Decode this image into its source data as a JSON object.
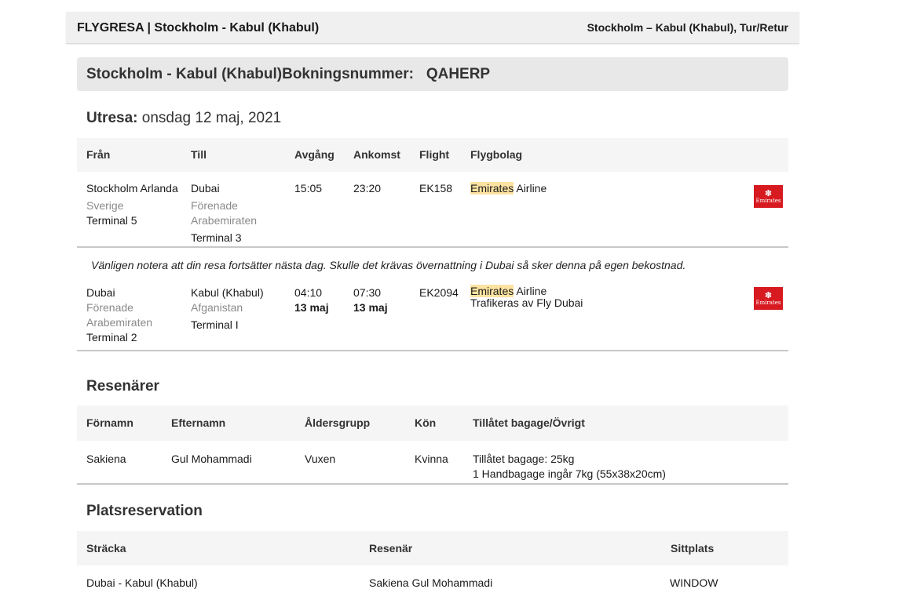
{
  "header": {
    "title": "FLYGRESA | Stockholm - Kabul (Khabul)",
    "route": "Stockholm – Kabul (Khabul), Tur/Retur"
  },
  "booking": {
    "route": "Stockholm - Kabul (Khabul)",
    "label": "Bokningsnummer:",
    "number": "QAHERP"
  },
  "outbound": {
    "label": "Utresa:",
    "date": "onsdag 12 maj, 2021",
    "columns": {
      "from": "Från",
      "to": "Till",
      "departure": "Avgång",
      "arrival": "Ankomst",
      "flight": "Flight",
      "airline": "Flygbolag"
    },
    "legs": [
      {
        "from_city": "Stockholm Arlanda",
        "from_country": "Sverige",
        "from_terminal": "Terminal 5",
        "to_city": "Dubai",
        "to_country": "Förenade Arabemiraten",
        "to_terminal": "Terminal 3",
        "dep_time": "15:05",
        "arr_time": "23:20",
        "flight": "EK158",
        "airline_name": "Emirates",
        "airline_suffix": " Airline",
        "operated_by": ""
      },
      {
        "from_city": "Dubai",
        "from_country": "Förenade Arabemiraten",
        "from_terminal": "Terminal 2",
        "to_city": "Kabul (Khabul)",
        "to_country": "Afganistan",
        "to_terminal": "Terminal I",
        "dep_time": "04:10",
        "dep_date": "13 maj",
        "arr_time": "07:30",
        "arr_date": "13 maj",
        "flight": "EK2094",
        "airline_name": "Emirates",
        "airline_suffix": " Airline",
        "operated_by": "Trafikeras av Fly Dubai"
      }
    ],
    "overnight_note": "Vänligen notera att din resa fortsätter nästa dag. Skulle det krävas övernattning i Dubai så sker denna på egen bekostnad."
  },
  "logo": {
    "text": "Emirates",
    "color": "#d71920"
  },
  "travelers": {
    "title": "Resenärer",
    "columns": {
      "first_name": "Förnamn",
      "last_name": "Efternamn",
      "age_group": "Åldersgrupp",
      "gender": "Kön",
      "baggage": "Tillåtet bagage/Övrigt"
    },
    "rows": [
      {
        "first_name": "Sakiena",
        "last_name": "Gul Mohammadi",
        "age_group": "Vuxen",
        "gender": "Kvinna",
        "baggage_line1": "Tillåtet bagage: 25kg",
        "baggage_line2": "1 Handbagage ingår 7kg (55x38x20cm)"
      }
    ]
  },
  "seats": {
    "title": "Platsreservation",
    "columns": {
      "segment": "Sträcka",
      "traveler": "Resenär",
      "seat": "Sittplats"
    },
    "rows": [
      {
        "segment": "Dubai - Kabul (Khabul)",
        "traveler": "Sakiena Gul Mohammadi",
        "seat": "WINDOW"
      }
    ]
  }
}
